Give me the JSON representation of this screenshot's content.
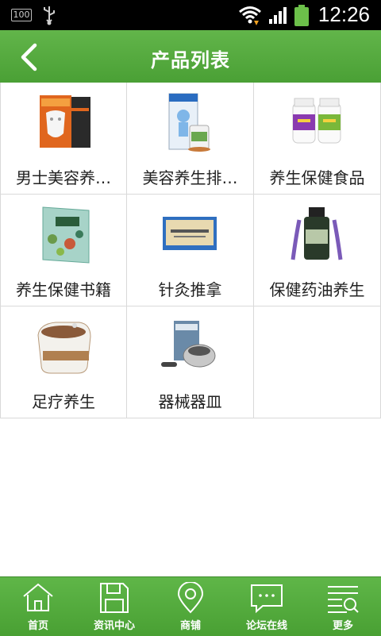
{
  "status_bar": {
    "battery_percent": "100",
    "time": "12:26"
  },
  "header": {
    "title": "产品列表"
  },
  "products": [
    {
      "label": "男士美容养…"
    },
    {
      "label": "美容养生排…"
    },
    {
      "label": "养生保健食品"
    },
    {
      "label": "养生保健书籍"
    },
    {
      "label": "针灸推拿"
    },
    {
      "label": "保健药油养生"
    },
    {
      "label": "足疗养生"
    },
    {
      "label": "器械器皿"
    }
  ],
  "tabbar": {
    "items": [
      {
        "label": "首页",
        "icon": "home-icon"
      },
      {
        "label": "资讯中心",
        "icon": "save-icon"
      },
      {
        "label": "商铺",
        "icon": "location-pin-icon"
      },
      {
        "label": "论坛在线",
        "icon": "chat-bubble-icon"
      },
      {
        "label": "更多",
        "icon": "list-search-icon"
      }
    ]
  },
  "colors": {
    "accent": "#4fa83a",
    "status_bar": "#000000"
  }
}
